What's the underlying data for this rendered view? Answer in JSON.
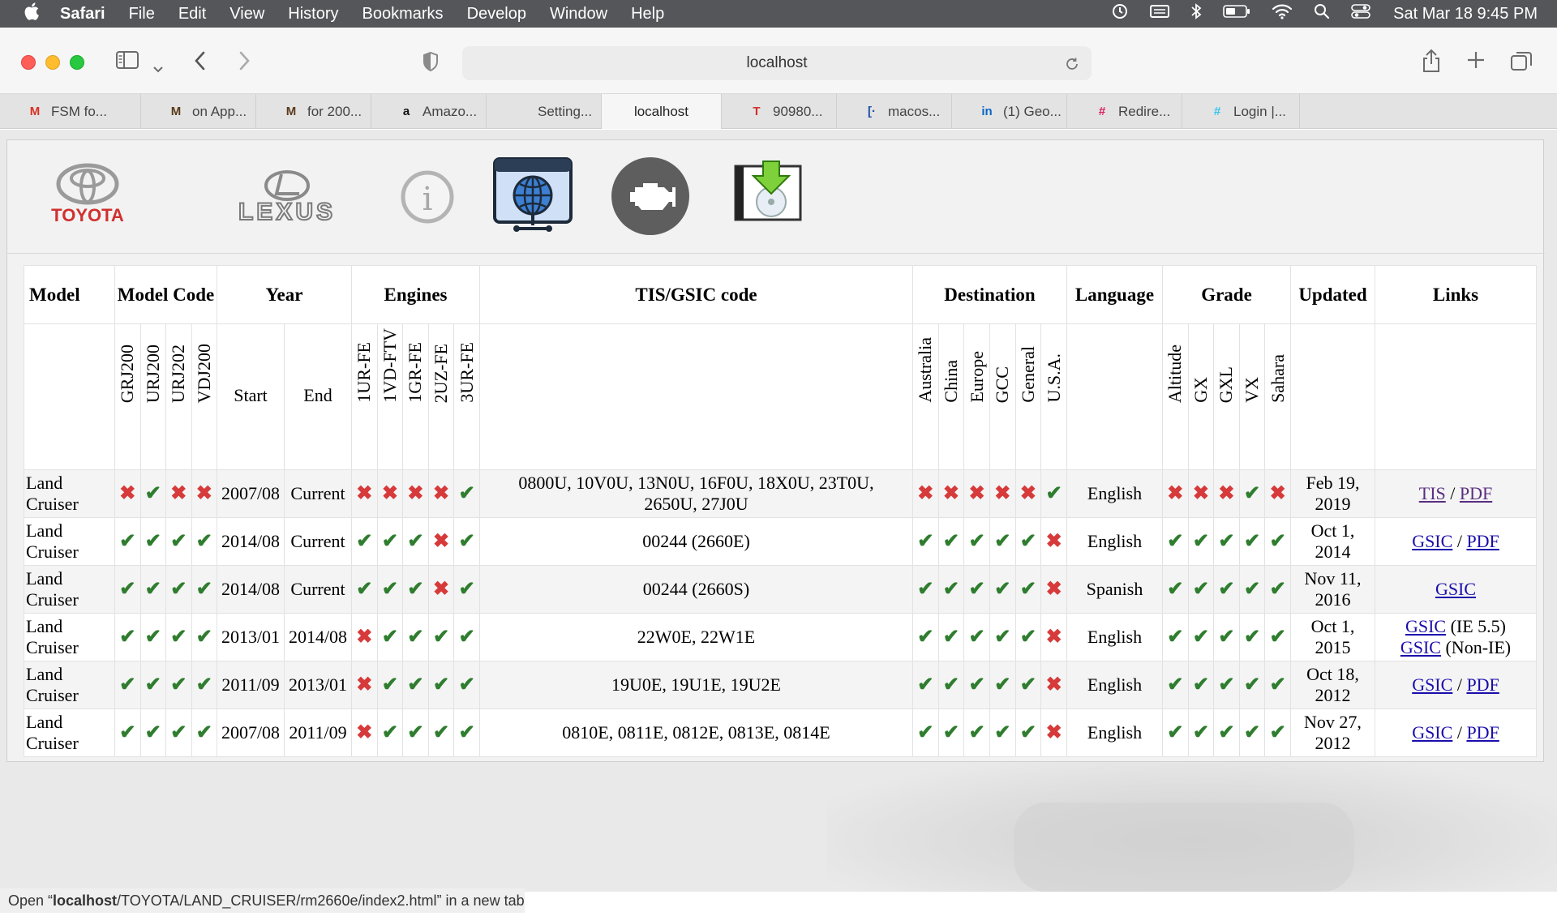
{
  "menubar": {
    "apple": "",
    "items": [
      "Safari",
      "File",
      "Edit",
      "View",
      "History",
      "Bookmarks",
      "Develop",
      "Window",
      "Help"
    ],
    "clock": "Sat Mar 18  9:45 PM"
  },
  "toolbar": {
    "url": "localhost"
  },
  "tabs": [
    {
      "label": "FSM fo...",
      "icon": "gmail-icon",
      "icon_text": "M",
      "icon_color": "#d93025"
    },
    {
      "label": "on App...",
      "icon": "m-logo-icon",
      "icon_text": "M",
      "icon_color": "#5a3a1a"
    },
    {
      "label": "for 200...",
      "icon": "m-logo-icon",
      "icon_text": "M",
      "icon_color": "#5a3a1a"
    },
    {
      "label": "Amazo...",
      "icon": "amazon-icon",
      "icon_text": "a",
      "icon_color": "#111111"
    },
    {
      "label": "Setting...",
      "icon": "apple-icon",
      "icon_text": "",
      "icon_color": "#777777"
    },
    {
      "label": "localhost",
      "icon": "",
      "icon_text": "",
      "icon_color": ""
    },
    {
      "label": "90980...",
      "icon": "toyota-icon",
      "icon_text": "T",
      "icon_color": "#d32f2f"
    },
    {
      "label": "macos...",
      "icon": "doc-icon",
      "icon_text": "[·",
      "icon_color": "#1f4fa3"
    },
    {
      "label": "(1) Geo...",
      "icon": "linkedin-icon",
      "icon_text": "in",
      "icon_color": "#0a66c2"
    },
    {
      "label": "Redire...",
      "icon": "slack-icon",
      "icon_text": "#",
      "icon_color": "#e01e5a"
    },
    {
      "label": "Login |...",
      "icon": "slack-icon",
      "icon_text": "#",
      "icon_color": "#36c5f0"
    }
  ],
  "nav_icons": {
    "toyota_label": "TOYOTA",
    "lexus_label": "LEXUS",
    "info_label": "i"
  },
  "table": {
    "headers": {
      "model": "Model",
      "model_code": "Model Code",
      "year": "Year",
      "engines": "Engines",
      "code": "TIS/GSIC code",
      "destination": "Destination",
      "language": "Language",
      "grade": "Grade",
      "updated": "Updated",
      "links": "Links"
    },
    "model_codes": [
      "GRJ200",
      "URJ200",
      "URJ202",
      "VDJ200"
    ],
    "year_cols": [
      "Start",
      "End"
    ],
    "engines": [
      "1UR-FE",
      "1VD-FTV",
      "1GR-FE",
      "2UZ-FE",
      "3UR-FE"
    ],
    "destinations": [
      "Australia",
      "China",
      "Europe",
      "GCC",
      "General",
      "U.S.A."
    ],
    "grades": [
      "Altitude",
      "GX",
      "GXL",
      "VX",
      "Sahara"
    ],
    "rows": [
      {
        "model": "Land Cruiser",
        "codes": [
          false,
          true,
          false,
          false
        ],
        "start": "2007/08",
        "end": "Current",
        "engines": [
          false,
          false,
          false,
          false,
          true
        ],
        "tis": "0800U, 10V0U, 13N0U, 16F0U, 18X0U, 23T0U, 2650U, 27J0U",
        "dest": [
          false,
          false,
          false,
          false,
          false,
          true
        ],
        "language": "English",
        "grades": [
          false,
          false,
          false,
          true,
          false
        ],
        "updated": "Feb 19, 2019",
        "links": [
          {
            "text": "TIS",
            "visited": true
          },
          {
            "sep": " / "
          },
          {
            "text": "PDF",
            "visited": true
          }
        ]
      },
      {
        "model": "Land Cruiser",
        "codes": [
          true,
          true,
          true,
          true
        ],
        "start": "2014/08",
        "end": "Current",
        "engines": [
          true,
          true,
          true,
          false,
          true
        ],
        "tis": "00244 (2660E)",
        "dest": [
          true,
          true,
          true,
          true,
          true,
          false
        ],
        "language": "English",
        "grades": [
          true,
          true,
          true,
          true,
          true
        ],
        "updated": "Oct 1, 2014",
        "links": [
          {
            "text": "GSIC"
          },
          {
            "sep": " / "
          },
          {
            "text": "PDF"
          }
        ]
      },
      {
        "model": "Land Cruiser",
        "codes": [
          true,
          true,
          true,
          true
        ],
        "start": "2014/08",
        "end": "Current",
        "engines": [
          true,
          true,
          true,
          false,
          true
        ],
        "tis": "00244 (2660S)",
        "dest": [
          true,
          true,
          true,
          true,
          true,
          false
        ],
        "language": "Spanish",
        "grades": [
          true,
          true,
          true,
          true,
          true
        ],
        "updated": "Nov 11, 2016",
        "links": [
          {
            "text": "GSIC"
          }
        ]
      },
      {
        "model": "Land Cruiser",
        "codes": [
          true,
          true,
          true,
          true
        ],
        "start": "2013/01",
        "end": "2014/08",
        "engines": [
          false,
          true,
          true,
          true,
          true
        ],
        "tis": "22W0E, 22W1E",
        "dest": [
          true,
          true,
          true,
          true,
          true,
          false
        ],
        "language": "English",
        "grades": [
          true,
          true,
          true,
          true,
          true
        ],
        "updated": "Oct 1, 2015",
        "links": [
          {
            "text": "GSIC"
          },
          {
            "sep": " (IE 5.5)"
          },
          {
            "br": true
          },
          {
            "text": "GSIC"
          },
          {
            "sep": " (Non-IE)"
          }
        ]
      },
      {
        "model": "Land Cruiser",
        "codes": [
          true,
          true,
          true,
          true
        ],
        "start": "2011/09",
        "end": "2013/01",
        "engines": [
          false,
          true,
          true,
          true,
          true
        ],
        "tis": "19U0E, 19U1E, 19U2E",
        "dest": [
          true,
          true,
          true,
          true,
          true,
          false
        ],
        "language": "English",
        "grades": [
          true,
          true,
          true,
          true,
          true
        ],
        "updated": "Oct 18, 2012",
        "links": [
          {
            "text": "GSIC"
          },
          {
            "sep": " / "
          },
          {
            "text": "PDF"
          }
        ]
      },
      {
        "model": "Land Cruiser",
        "codes": [
          true,
          true,
          true,
          true
        ],
        "start": "2007/08",
        "end": "2011/09",
        "engines": [
          false,
          true,
          true,
          true,
          true
        ],
        "tis": "0810E, 0811E, 0812E, 0813E, 0814E",
        "dest": [
          true,
          true,
          true,
          true,
          true,
          false
        ],
        "language": "English",
        "grades": [
          true,
          true,
          true,
          true,
          true
        ],
        "updated": "Nov 27, 2012",
        "links": [
          {
            "text": "GSIC"
          },
          {
            "sep": " / "
          },
          {
            "text": "PDF"
          }
        ]
      }
    ]
  },
  "status": {
    "prefix": "Open “",
    "host": "localhost",
    "path": "/TOYOTA/LAND_CRUISER/rm2660e/index2.html",
    "suffix": "” in a new tab"
  },
  "colors": {
    "ok": "#2f7d2f",
    "no": "#d63a3a",
    "link": "#1a0dab",
    "visited": "#5a2d82"
  }
}
